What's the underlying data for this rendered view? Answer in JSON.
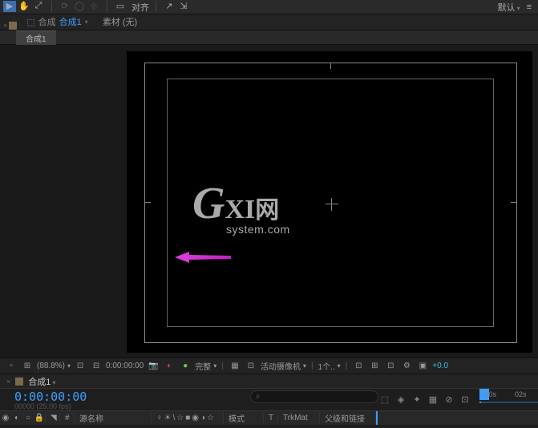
{
  "toolbar": {
    "align_label": "对齐",
    "workspace_label": "默认"
  },
  "panel_tabs": {
    "prefix": "合成",
    "active": "合成1",
    "material": "素材",
    "material_value": "(无)"
  },
  "subtab": "合成1",
  "watermark": {
    "line1_g": "G",
    "line1_xi": "XI",
    "line1_cn": "网",
    "line2": "system.com"
  },
  "viewer_controls": {
    "zoom": "(88.8%)",
    "timecode": "0:00:00:00",
    "quality": "完整",
    "camera": "活动摄像机",
    "views": "1个..",
    "exposure": "+0.0"
  },
  "timeline": {
    "comp_name": "合成1",
    "timecode": "0:00:00:00",
    "timecode_sub": "00000 (25.00 fps)",
    "ruler_marks": [
      ":00s",
      "02s"
    ],
    "columns": {
      "num": "#",
      "source_name": "源名称",
      "switches": "♀☀\\☆■◉◑☆",
      "mode": "模式",
      "trkmat": "TrkMat",
      "parent": "父级和链接",
      "t": "T"
    }
  }
}
